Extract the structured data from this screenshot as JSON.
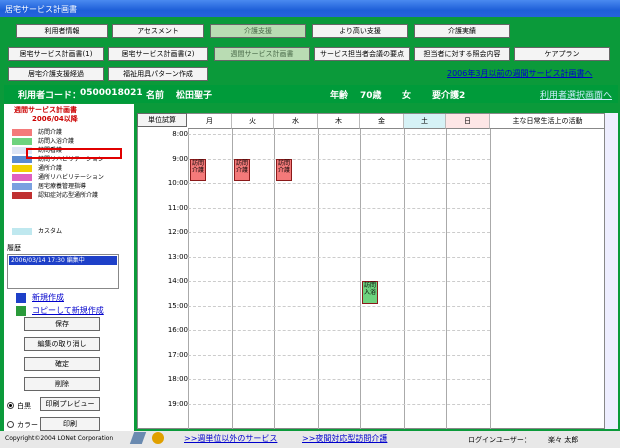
{
  "window": {
    "title": "居宅サービス計画書"
  },
  "nav_row1": [
    "利用者情報",
    "アセスメント",
    "介護支援",
    "より高い支援",
    "介護実績"
  ],
  "nav_row2": [
    "居宅サービス計画書(1)",
    "居宅サービス計画書(2)",
    "週間サービス計画書",
    "サービス担当者会議の要点",
    "担当者に対する照会内容",
    "ケアプラン"
  ],
  "nav_row3": [
    "居宅介護支援経過",
    "福祉用具パターン作成"
  ],
  "link_prior": "2006年3月以前の週間サービス計画書へ",
  "info": {
    "code_label": "利用者コード：",
    "code": "0500018021",
    "name_label": "名前",
    "name": "松田聖子",
    "age_label": "年齢",
    "age": "70歳",
    "gender": "女",
    "care_level": "要介護2",
    "select_link": "利用者選択画面へ"
  },
  "sidebar": {
    "title": "週間サービス計画書",
    "period": "2006/04以降",
    "legend": [
      {
        "label": "訪問介護",
        "color": "#f47a7a"
      },
      {
        "label": "訪問入浴介護",
        "color": "#6ed27e"
      },
      {
        "label": "訪問看護",
        "color": "#dce4f4"
      },
      {
        "label": "訪問リハビリテーション",
        "color": "#5a8ad0"
      },
      {
        "label": "通所介護",
        "color": "#f2d000"
      },
      {
        "label": "通所リハビリテーション",
        "color": "#e060c0"
      },
      {
        "label": "居宅療養管理指導",
        "color": "#7aa0e0"
      },
      {
        "label": "認知症対応型通所介護",
        "color": "#c03030"
      }
    ],
    "custom_label": "カスタム",
    "custom_color": "#bfe8ef",
    "history_label": "履歴",
    "history_item": "2006/03/14 17:30 編集中",
    "new_link": "新規作成",
    "copy_link": "コピーして新規作成",
    "save": "保存",
    "cancel_edit": "編集の取り消し",
    "confirm": "確定",
    "delete": "削除",
    "print_preview": "印刷プレビュー",
    "print": "印刷",
    "mono": "白黒",
    "color": "カラー"
  },
  "calendar": {
    "unit_button": "単位試算",
    "days": [
      "月",
      "火",
      "水",
      "木",
      "金",
      "土",
      "日"
    ],
    "saturday_bg": "#d6f2f6",
    "sunday_bg": "#fde6e6",
    "activities_header": "主な日常生活上の活動",
    "hours": [
      "8:00",
      "9:00",
      "10:00",
      "11:00",
      "12:00",
      "13:00",
      "14:00",
      "15:00",
      "16:00",
      "17:00",
      "18:00",
      "19:00"
    ],
    "events": [
      {
        "day": 0,
        "start": 9.0,
        "end": 10.0,
        "label": "訪問介護",
        "kind": "訪問介護"
      },
      {
        "day": 1,
        "start": 9.0,
        "end": 10.0,
        "label": "訪問介護",
        "kind": "訪問介護"
      },
      {
        "day": 2,
        "start": 9.0,
        "end": 10.0,
        "label": "訪問介護",
        "kind": "訪問介護"
      },
      {
        "day": 4,
        "start": 14.0,
        "end": 15.0,
        "label": "訪問入浴",
        "kind": "訪問入浴介護"
      }
    ]
  },
  "bottom": {
    "service_link": ">>週単位以外のサービス",
    "night_link": ">>夜間対応型訪問介護",
    "copyright": "Copyright©2004 LONet Corporation",
    "login_label": "ログインユーザー：",
    "login_user": "楽々 太郎"
  }
}
